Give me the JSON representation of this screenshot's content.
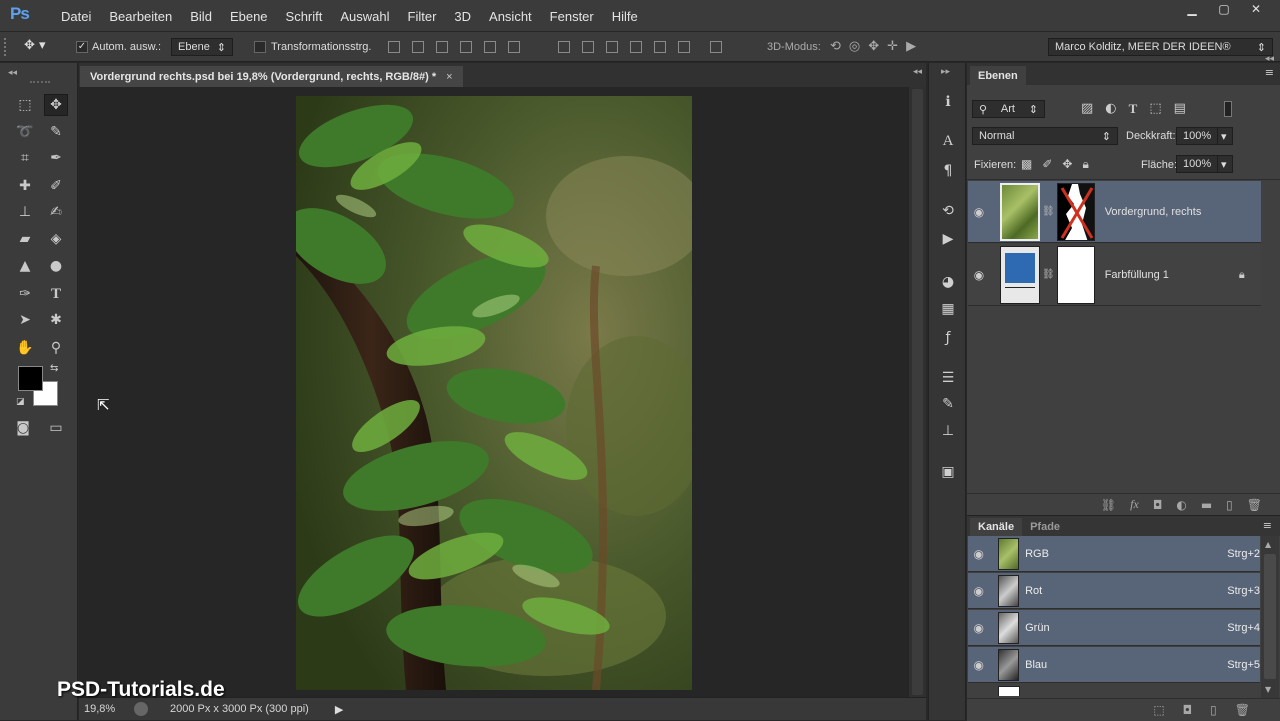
{
  "app": {
    "logo": "Ps"
  },
  "menu": [
    "Datei",
    "Bearbeiten",
    "Bild",
    "Ebene",
    "Schrift",
    "Auswahl",
    "Filter",
    "3D",
    "Ansicht",
    "Fenster",
    "Hilfe"
  ],
  "window_controls": {
    "minimize": "▁",
    "maximize": "▢",
    "close": "✕"
  },
  "options": {
    "auto_select_label": "Autom. ausw.:",
    "auto_select_checked": true,
    "auto_select_target": "Ebene",
    "transform_label": "Transformationsstrg.",
    "mode3d_label": "3D-Modus:",
    "workspace": "Marco Kolditz, MEER DER IDEEN®"
  },
  "document": {
    "tab_title": "Vordergrund rechts.psd bei 19,8% (Vordergrund, rechts, RGB/8#) *",
    "tab_close": "×",
    "zoom": "19,8%",
    "size_info": "2000 Px x 3000 Px (300 ppi)"
  },
  "colors": {
    "foreground": "#000000",
    "background": "#ffffff",
    "accent": "#586478",
    "fill_layer": "#2e6ab1"
  },
  "layers_panel": {
    "tab": "Ebenen",
    "filter_kind": "Art",
    "blend_mode": "Normal",
    "opacity_label": "Deckkraft:",
    "opacity": "100%",
    "lock_label": "Fixieren:",
    "fill_label": "Fläche:",
    "fill": "100%",
    "layers": [
      {
        "name": "Vordergrund, rechts",
        "selected": true,
        "visible": true
      },
      {
        "name": "Farbfüllung 1",
        "selected": false,
        "visible": true,
        "locked": true
      }
    ]
  },
  "channels_panel": {
    "tabs": [
      "Kanäle",
      "Pfade"
    ],
    "channels": [
      {
        "name": "RGB",
        "shortcut": "Strg+2"
      },
      {
        "name": "Rot",
        "shortcut": "Strg+3"
      },
      {
        "name": "Grün",
        "shortcut": "Strg+4"
      },
      {
        "name": "Blau",
        "shortcut": "Strg+5"
      }
    ]
  },
  "watermark": "PSD-Tutorials.de"
}
